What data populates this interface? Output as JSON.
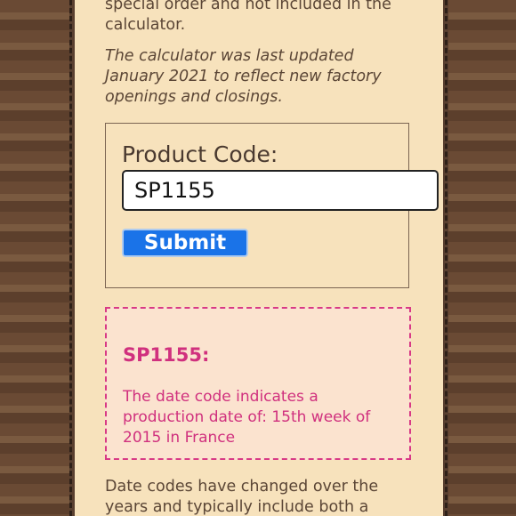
{
  "intro": {
    "cut_text": "special order and not included in the calculator.",
    "update_note": "The calculator was last updated January 2021 to reflect new factory openings and closings."
  },
  "form": {
    "label": "Product Code:",
    "input_value": "SP1155",
    "submit_label": "Submit"
  },
  "result": {
    "code": "SP1155:",
    "message": "The date code indicates a production date of: 15th week of 2015 in France"
  },
  "footer": {
    "text": "Date codes have changed over the years and typically include both a factory"
  },
  "colors": {
    "panel_bg": "#f7e2bc",
    "accent_pink": "#d0307e",
    "button_blue": "#1a73e8",
    "border_brown": "#5a4030"
  }
}
